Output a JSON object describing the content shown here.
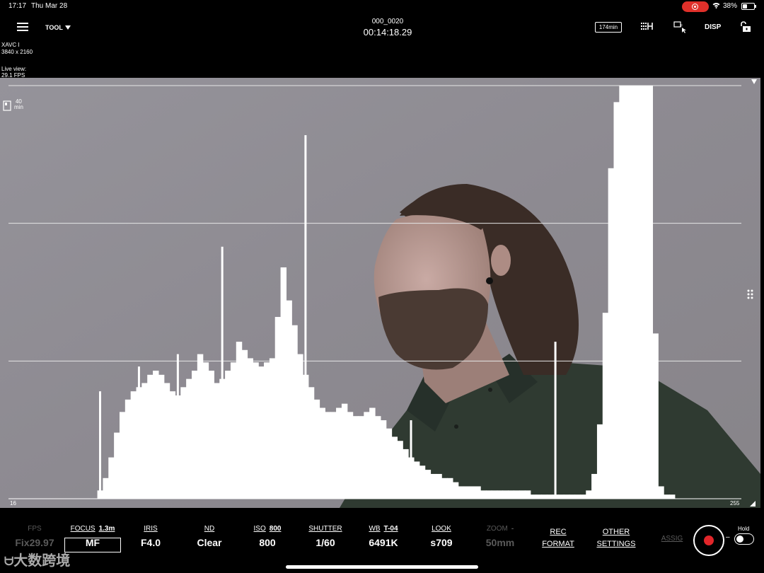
{
  "status_bar": {
    "time": "17:17",
    "date": "Thu Mar 28",
    "battery_pct": "38%",
    "battery_level": 0.38
  },
  "toolbar": {
    "tool_label": "TOOL",
    "clip_name": "000_0020",
    "timecode": "00:14:18.29",
    "media_remaining": "174min",
    "disp_label": "DISP"
  },
  "info": {
    "codec": "XAVC I",
    "resolution": "3840 x 2160",
    "live_view_label": "Live view:",
    "live_view_fps": "29.1 FPS",
    "media_card_minutes": "40",
    "media_card_unit": "min"
  },
  "histogram": {
    "min_label": "16",
    "max_label": "255",
    "bins": [
      0,
      0,
      0,
      0,
      0,
      0,
      0,
      0,
      0,
      0,
      0,
      0,
      0,
      0,
      0,
      0,
      0.02,
      0.05,
      0.1,
      0.16,
      0.21,
      0.24,
      0.26,
      0.27,
      0.28,
      0.3,
      0.31,
      0.3,
      0.28,
      0.26,
      0.25,
      0.27,
      0.29,
      0.31,
      0.35,
      0.33,
      0.31,
      0.28,
      0.29,
      0.31,
      0.33,
      0.38,
      0.36,
      0.34,
      0.33,
      0.32,
      0.33,
      0.34,
      0.44,
      0.56,
      0.48,
      0.42,
      0.35,
      0.3,
      0.27,
      0.24,
      0.22,
      0.21,
      0.21,
      0.22,
      0.23,
      0.21,
      0.2,
      0.2,
      0.21,
      0.22,
      0.2,
      0.19,
      0.17,
      0.15,
      0.14,
      0.12,
      0.1,
      0.09,
      0.08,
      0.07,
      0.06,
      0.06,
      0.05,
      0.05,
      0.04,
      0.03,
      0.03,
      0.03,
      0.03,
      0.02,
      0.02,
      0.02,
      0.02,
      0.02,
      0.02,
      0.02,
      0.02,
      0.02,
      0.01,
      0.01,
      0.01,
      0.01,
      0.01,
      0.01,
      0.01,
      0.01,
      0.01,
      0.01,
      0.02,
      0.06,
      0.18,
      0.45,
      0.8,
      0.96,
      1,
      1,
      1,
      1,
      1,
      1,
      0.4,
      0.03,
      0.01,
      0.01,
      0.0,
      0,
      0,
      0,
      0,
      0,
      0,
      0,
      0,
      0,
      0,
      0
    ],
    "spikes": [
      {
        "bin": 16,
        "level": 0.26
      },
      {
        "bin": 23,
        "level": 0.32
      },
      {
        "bin": 30,
        "level": 0.35
      },
      {
        "bin": 38,
        "level": 0.61
      },
      {
        "bin": 53,
        "level": 0.88
      },
      {
        "bin": 66,
        "level": 0.18
      },
      {
        "bin": 72,
        "level": 0.19
      },
      {
        "bin": 98,
        "level": 0.38
      }
    ]
  },
  "settings": {
    "fps": {
      "label": "FPS",
      "value": "Fix29.97"
    },
    "focus": {
      "label": "FOCUS",
      "sub": "1.3m",
      "value": "MF"
    },
    "iris": {
      "label": "IRIS",
      "value": "F4.0"
    },
    "nd": {
      "label": "ND",
      "value": "Clear"
    },
    "iso": {
      "label": "ISO",
      "sub": "800",
      "value": "800"
    },
    "shutter": {
      "label": "SHUTTER",
      "value": "1/60"
    },
    "wb": {
      "label": "WB",
      "sub": "T-04",
      "value": "6491K"
    },
    "look": {
      "label": "LOOK",
      "value": "s709"
    },
    "zoom": {
      "label": "ZOOM",
      "sub": "-",
      "value": "50mm"
    },
    "rec_format": {
      "line1": "REC",
      "line2": "FORMAT"
    },
    "other_settings": {
      "line1": "OTHER",
      "line2": "SETTINGS"
    },
    "assign": {
      "label": "ASSIG"
    },
    "hold": {
      "label": "Hold",
      "dash": "–"
    }
  },
  "watermark": {
    "text": "大数跨境"
  },
  "colors": {
    "record_red": "#e2262a",
    "status_red": "#e0302a",
    "scene_gray": "#8e8b91",
    "shirt_green": "#2f3a31"
  }
}
